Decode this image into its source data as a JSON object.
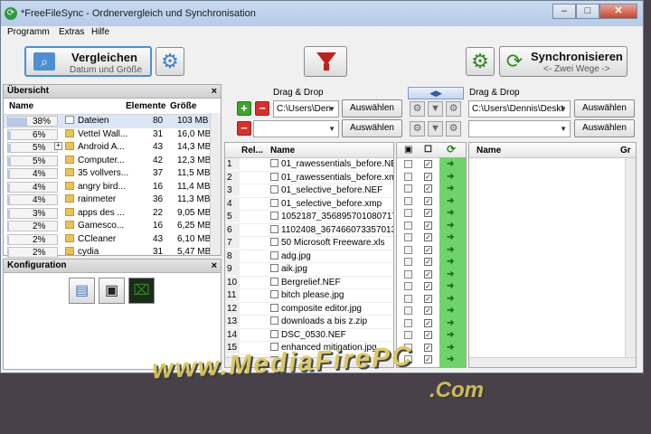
{
  "window": {
    "title": "*FreeFileSync - Ordnervergleich und Synchronisation",
    "controls": [
      "–",
      "□",
      "✕"
    ]
  },
  "menu": [
    "Programm",
    "Extras",
    "Hilfe"
  ],
  "toolbar": {
    "compare_label": "Vergleichen",
    "compare_sub": "Datum und Größe",
    "sync_label": "Synchronisieren",
    "sync_sub": "<- Zwei Wege ->"
  },
  "overview": {
    "title": "Übersicht",
    "columns": [
      "Name",
      "Elemente",
      "Größe"
    ],
    "rows": [
      {
        "pct": "38%",
        "fill": 0.38,
        "name": "Dateien",
        "count": "80",
        "size": "103 MB",
        "type": "file"
      },
      {
        "pct": "6%",
        "fill": 0.06,
        "name": "Vettel Wall...",
        "count": "31",
        "size": "16,0 MB",
        "type": "folder"
      },
      {
        "pct": "5%",
        "fill": 0.05,
        "name": "Android A...",
        "count": "43",
        "size": "14,3 MB",
        "type": "folder",
        "expand": true
      },
      {
        "pct": "5%",
        "fill": 0.05,
        "name": "Computer...",
        "count": "42",
        "size": "12,3 MB",
        "type": "folder"
      },
      {
        "pct": "4%",
        "fill": 0.04,
        "name": "35 vollvers...",
        "count": "37",
        "size": "11,5 MB",
        "type": "folder"
      },
      {
        "pct": "4%",
        "fill": 0.04,
        "name": "angry bird...",
        "count": "16",
        "size": "11,4 MB",
        "type": "folder"
      },
      {
        "pct": "4%",
        "fill": 0.04,
        "name": "rainmeter",
        "count": "36",
        "size": "11,3 MB",
        "type": "folder"
      },
      {
        "pct": "3%",
        "fill": 0.03,
        "name": "apps des ...",
        "count": "22",
        "size": "9,05 MB",
        "type": "folder"
      },
      {
        "pct": "2%",
        "fill": 0.02,
        "name": "Gamesco...",
        "count": "16",
        "size": "6,25 MB",
        "type": "folder"
      },
      {
        "pct": "2%",
        "fill": 0.02,
        "name": "CCleaner",
        "count": "43",
        "size": "6,10 MB",
        "type": "folder"
      },
      {
        "pct": "2%",
        "fill": 0.02,
        "name": "cydia",
        "count": "31",
        "size": "5,47 MB",
        "type": "folder"
      }
    ]
  },
  "config": {
    "title": "Konfiguration"
  },
  "left": {
    "dnd": "Drag & Drop",
    "path1": "C:\\Users\\Den",
    "path2": "",
    "select1": "Auswählen",
    "select2": "Auswählen"
  },
  "right": {
    "dnd": "Drag & Drop",
    "path1": "C:\\Users\\Dennis\\Deskt",
    "path2": "",
    "select1": "Auswählen",
    "select2": "Auswählen"
  },
  "grid_left": {
    "columns": [
      "Rel...",
      "Name"
    ],
    "rows": [
      "01_rawessentials_before.NEF",
      "01_rawessentials_before.xmp",
      "01_selective_before.NEF",
      "01_selective_before.xmp",
      "1052187_356895701080717_17",
      "1102408_367466073357013_93",
      "50 Microsoft Freeware.xls",
      "adg.jpg",
      "aik.jpg",
      "Bergrelief.NEF",
      "bitch please.jpg",
      "composite editor.jpg",
      "downloads a bis z.zip",
      "DSC_0530.NEF",
      "enhanced mitigation.jpg",
      "entfernen zum bösartigen.jpg",
      "groß.jpg"
    ]
  },
  "grid_right": {
    "columns": [
      "Name",
      "Gr"
    ]
  },
  "watermark": {
    "line1": "www.MediaFirePC",
    "line2": ".Com"
  },
  "colors": {
    "accent": "#4a90d8",
    "sync_green": "#6fd26a",
    "filter_red": "#c0201b"
  }
}
